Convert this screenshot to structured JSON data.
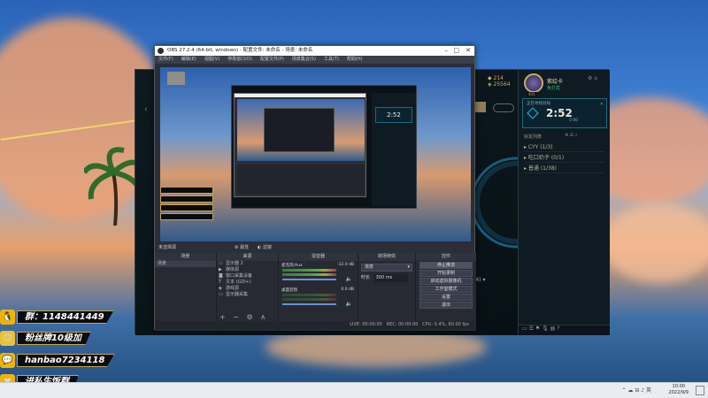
{
  "obs": {
    "title": "OBS 27.2.4 (64-bit, windows) - 配置文件: 未命名 - 场景: 未命名",
    "menu": [
      "文件(F)",
      "编辑(E)",
      "视图(V)",
      "停靠窗口(D)",
      "配置文件(P)",
      "场景集合(S)",
      "工具(T)",
      "帮助(H)"
    ],
    "scene_label": "未选择源",
    "properties_button": "属性",
    "filters_button": "滤镜",
    "panels": {
      "scenes": "场景",
      "sources": "来源",
      "mixer": "混音器",
      "transitions": "转场特效",
      "controls": "控件"
    },
    "scenes_list": [
      "场景"
    ],
    "sources_list": [
      "显示器 2",
      "媒体源",
      "窗口采集设备",
      "文本 (GDI+)",
      "游戏源",
      "显示器采集"
    ],
    "mixer": {
      "tracks": [
        {
          "name": "麦克风/Aux",
          "db": "-12.0 dB"
        },
        {
          "name": "桌面音频",
          "db": "0.0 dB"
        }
      ]
    },
    "transitions": {
      "type": "渐变",
      "duration_label": "时长",
      "duration_value": "300 ms"
    },
    "controls": [
      "停止推流",
      "开始录制",
      "启动虚拟摄像机",
      "工作室模式",
      "设置",
      "退出"
    ],
    "status": {
      "live": "LIVE: 00:00:00",
      "rec": "REC: 00:00:00",
      "cpu": "CPU: 0.4%, 60.00 fps"
    }
  },
  "lol": {
    "coins_1": "214",
    "coins_2": "25564",
    "username": "紫绘卡",
    "status_line": "免打扰",
    "level": "441",
    "queue_label": "正在寻找对局",
    "timer": "2:52",
    "timer_sub": "5:00",
    "friends_header": "好友列表",
    "friend_groups": [
      "CYY (1/3)",
      "吃口奶子 (0/1)",
      "普通 (1/38)"
    ],
    "dropdown": "(4)"
  },
  "overlay": {
    "badges": [
      {
        "text": "群：1148441449",
        "icon": "qq-penguin-icon",
        "color": "#f0b400"
      },
      {
        "text": "粉丝牌10级加",
        "icon": "emoji-face-icon",
        "color": "#e8c23a"
      },
      {
        "text": "hanbao7234118",
        "icon": "wechat-icon",
        "color": "#f0b400"
      },
      {
        "text": "进私生饭群",
        "icon": "heart-icon",
        "color": "#f0b400"
      }
    ]
  },
  "taskbar": {
    "time": "10:00",
    "date": "2022/9/9"
  },
  "colors": {
    "obs_bg": "#2b2e38",
    "badge_border": "#c7a54a",
    "lol_accent": "#c8aa6e"
  }
}
